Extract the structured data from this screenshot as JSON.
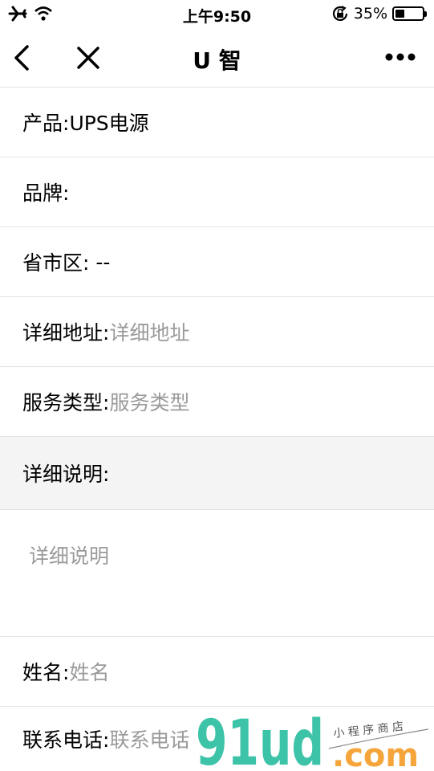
{
  "status_bar": {
    "time": "上午9:50",
    "battery_percent": "35%",
    "battery_level": 0.35
  },
  "nav": {
    "title": "U 智"
  },
  "form": {
    "product_label": "产品:",
    "product_value": "UPS电源",
    "brand_label": "品牌:",
    "region_label": "省市区:",
    "region_value": " --",
    "address_label": "详细地址:",
    "address_placeholder": "详细地址",
    "service_type_label": "服务类型:",
    "service_type_placeholder": "服务类型",
    "description_label": "详细说明:",
    "description_placeholder": "详细说明",
    "name_label": "姓名:",
    "name_placeholder": "姓名",
    "phone_label": "联系电话:",
    "phone_placeholder": "联系电话"
  },
  "watermark": {
    "brand": "91ud",
    "domain": ".com",
    "tagline": "小 程 序 商 店"
  },
  "colors": {
    "watermark_teal": "#3cc3a8",
    "watermark_orange": "#f5a53a",
    "divider": "#e3e3e3",
    "placeholder": "#9a9a9a",
    "section_background": "#f4f4f4"
  }
}
